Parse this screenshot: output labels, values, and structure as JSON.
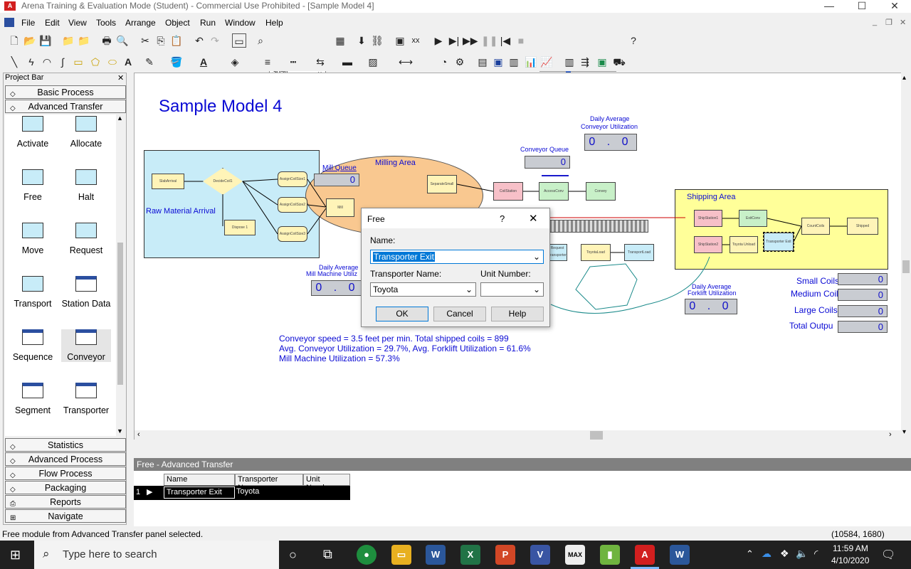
{
  "window": {
    "title": "Arena Training & Evaluation Mode (Student) - Commercial Use Prohibited - [Sample Model 4]",
    "logo": "A"
  },
  "menu": [
    "File",
    "Edit",
    "View",
    "Tools",
    "Arrange",
    "Object",
    "Run",
    "Window",
    "Help"
  ],
  "toolbar": {
    "zoom": "30%"
  },
  "project_bar": {
    "title": "Project Bar",
    "top_panels": [
      "Basic Process",
      "Advanced Transfer"
    ],
    "modules": [
      {
        "label": "Activate",
        "kind": "shape"
      },
      {
        "label": "Allocate",
        "kind": "shape"
      },
      {
        "label": "Free",
        "kind": "shape"
      },
      {
        "label": "Halt",
        "kind": "shape"
      },
      {
        "label": "Move",
        "kind": "shape"
      },
      {
        "label": "Request",
        "kind": "shape"
      },
      {
        "label": "Transport",
        "kind": "shape"
      },
      {
        "label": "Station Data",
        "kind": "grid"
      },
      {
        "label": "Sequence",
        "kind": "grid"
      },
      {
        "label": "Conveyor",
        "kind": "grid"
      },
      {
        "label": "Segment",
        "kind": "grid"
      },
      {
        "label": "Transporter",
        "kind": "grid"
      }
    ],
    "bottom_panels": [
      "Statistics",
      "Advanced Process",
      "Flow Process",
      "Packaging",
      "Reports",
      "Navigate"
    ]
  },
  "canvas": {
    "model_title": "Sample Model 4",
    "raw_material_label": "Raw Material Arrival",
    "mill_queue_label": "Mill Queue",
    "mill_queue_value": "0",
    "milling_area_label": "Milling Area",
    "conveyor_queue_label": "Conveyor Queue",
    "conveyor_queue_value": "0",
    "conveyor_util_label_1": "Daily Average",
    "conveyor_util_label_2": "Conveyor Utilization",
    "conveyor_util_value": "0 . 0",
    "mill_util_label_1": "Daily Average",
    "mill_util_label_2": "Mill Machine Utiliz",
    "mill_util_value": "0 . 0",
    "forklift_util_label_1": "Daily Average",
    "forklift_util_label_2": "Forklift Utilization",
    "forklift_util_value": "0 . 0",
    "shipping_area_label": "Shipping Area",
    "nodes": {
      "slab_arrival": "SlabArrival",
      "decide_coil": "DecideCoil1",
      "dispose": "Dispose 1",
      "assign1": "AssignCoilSize1",
      "assign2": "AssignCoilSize2",
      "assign3": "AssignCoilSize3",
      "mill": "Mill",
      "separate": "SeparateSmall",
      "decide_coil2": "DecideCoil2",
      "coil_station": "CoilStation",
      "access_conv": "AccessConv",
      "convey": "Convey",
      "toyota_load": "ToyotaLoad",
      "transport_load": "TransportLoad",
      "request_transporter": "Request Transporter",
      "ship_station1": "ShipStation1",
      "exit_conv": "ExitConv",
      "count_coils": "CountCoils",
      "shipped": "Shipped",
      "ship_station2": "ShipStation2",
      "toyota_unload": "Toyota Unload",
      "transporter_exit": "Transporter Exit"
    },
    "counters": [
      {
        "label": "Small Coils",
        "value": "0"
      },
      {
        "label": "Medium Coils",
        "value": "0"
      },
      {
        "label": "Large Coils",
        "value": "0"
      },
      {
        "label": "Total Outpu",
        "value": "0"
      }
    ],
    "notes": [
      "Conveyor speed = 3.5 feet per min. Total shipped coils = 899",
      "Avg. Conveyor Utilization = 29.7%, Avg. Forklift Utilization = 61.6%",
      "Mill Machine Utilization = 57.3%"
    ]
  },
  "dialog": {
    "title": "Free",
    "help_glyph": "?",
    "name_label": "Name:",
    "name_value": "Transporter Exit",
    "transporter_label": "Transporter Name:",
    "transporter_value": "Toyota",
    "unit_label": "Unit Number:",
    "unit_value": "",
    "ok": "OK",
    "cancel": "Cancel",
    "help": "Help"
  },
  "grid": {
    "title": "Free - Advanced Transfer",
    "columns": [
      "Name",
      "Transporter Name",
      "Unit Number"
    ],
    "rows": [
      {
        "index": "1",
        "name": "Transporter Exit",
        "transporter": "Toyota",
        "unit": ""
      }
    ]
  },
  "status": {
    "message": "Free module from Advanced Transfer panel selected.",
    "coords": "(10584, 1680)"
  },
  "taskbar": {
    "search_placeholder": "Type here to search",
    "time": "11:59 AM",
    "date": "4/10/2020"
  }
}
